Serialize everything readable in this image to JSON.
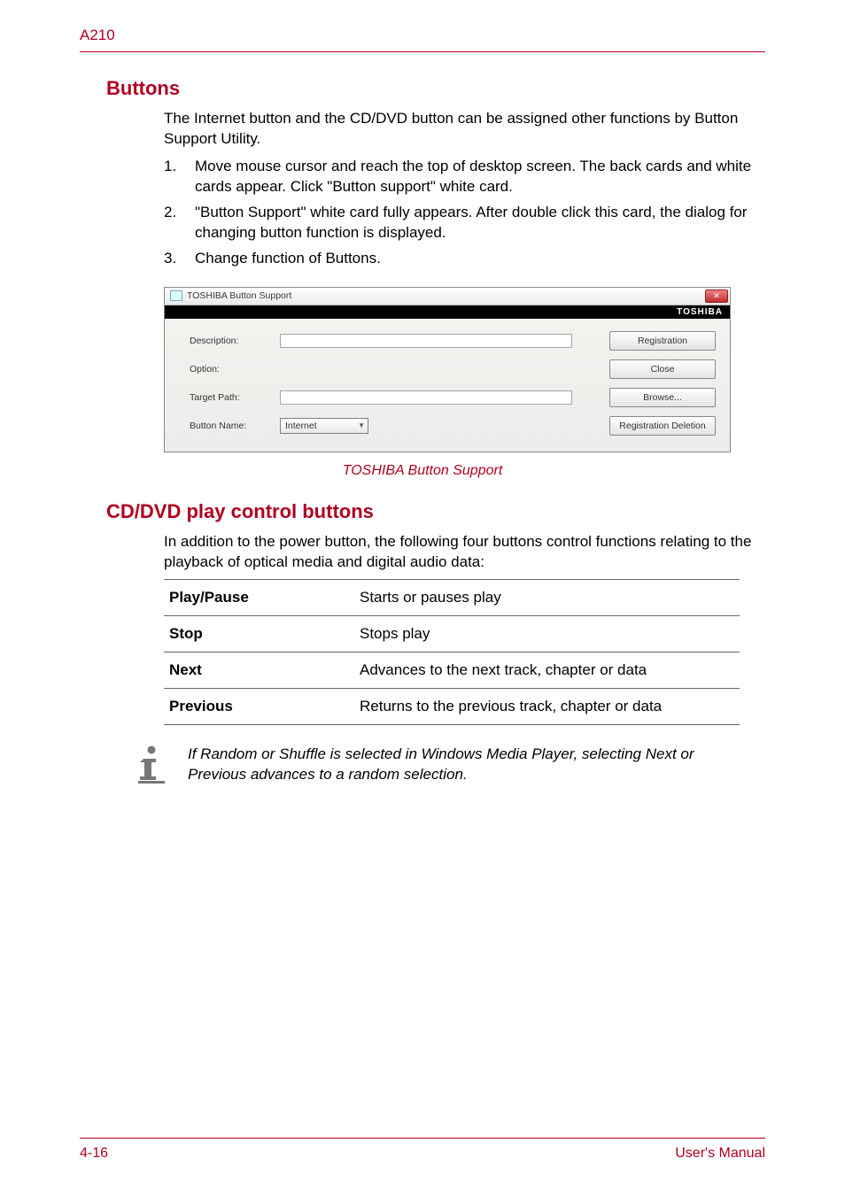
{
  "header": {
    "model": "A210"
  },
  "sections": {
    "buttons": {
      "title": "Buttons",
      "intro": "The Internet button and the CD/DVD button can be assigned other functions by Button Support Utility.",
      "steps": [
        "Move mouse cursor and reach the top of desktop screen. The back cards and white cards appear. Click \"Button support\" white card.",
        "\"Button Support\" white card fully appears. After double click this card, the dialog for changing button function is displayed.",
        "Change function of Buttons."
      ],
      "caption": "TOSHIBA Button Support"
    },
    "cddvd": {
      "title": "CD/DVD play control buttons",
      "intro": "In addition to the power button, the following four buttons control functions relating to the playback of optical media and digital audio data:",
      "table": [
        {
          "name": "Play/Pause",
          "desc": "Starts or pauses play"
        },
        {
          "name": "Stop",
          "desc": "Stops play"
        },
        {
          "name": "Next",
          "desc": "Advances to the next track, chapter or data"
        },
        {
          "name": "Previous",
          "desc": "Returns to the previous track, chapter or data"
        }
      ],
      "note": "If Random or Shuffle is selected in Windows Media Player, selecting Next or Previous advances to a random selection."
    }
  },
  "dialog": {
    "title": "TOSHIBA Button Support",
    "brand": "TOSHIBA",
    "labels": {
      "description": "Description:",
      "option": "Option:",
      "target_path": "Target Path:",
      "button_name": "Button Name:"
    },
    "combo_value": "Internet",
    "buttons": {
      "registration": "Registration",
      "close": "Close",
      "browse": "Browse...",
      "registration_deletion": "Registration Deletion"
    }
  },
  "footer": {
    "page": "4-16",
    "doc": "User's Manual"
  }
}
